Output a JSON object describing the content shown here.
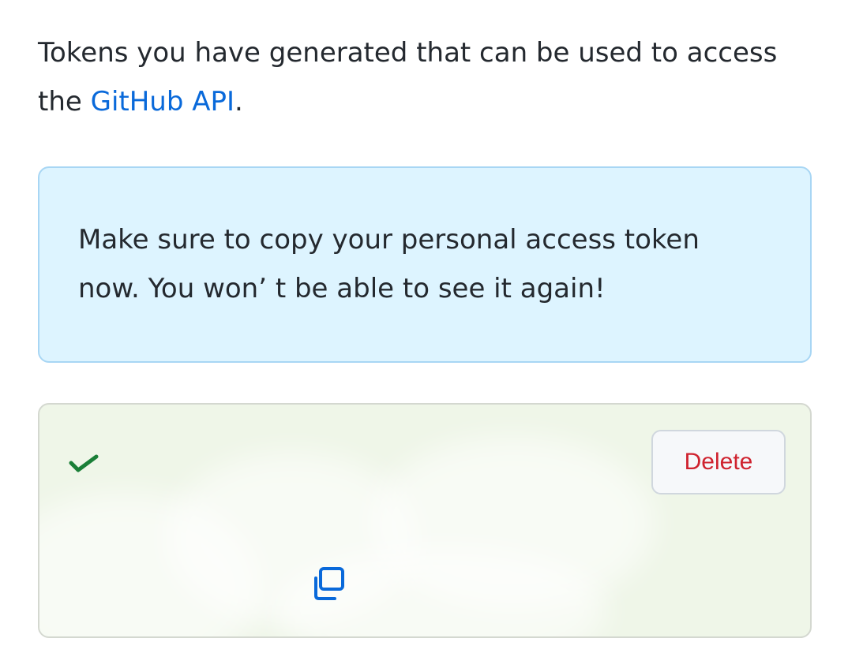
{
  "intro": {
    "text_before_link": "Tokens you have generated that can be used to access the ",
    "link_text": "GitHub API",
    "text_after_link": "."
  },
  "notice": {
    "message": "Make sure to copy your personal access token now. You won’ t be able to see it again!"
  },
  "token": {
    "delete_label": "Delete",
    "status_icon": "check-icon",
    "copy_icon": "copy-icon"
  },
  "colors": {
    "link": "#0969da",
    "notice_bg": "#ddf4ff",
    "notice_border": "#a8d6f4",
    "success_bg": "#eff6e8",
    "danger": "#cf222e",
    "check": "#1a7f37"
  }
}
